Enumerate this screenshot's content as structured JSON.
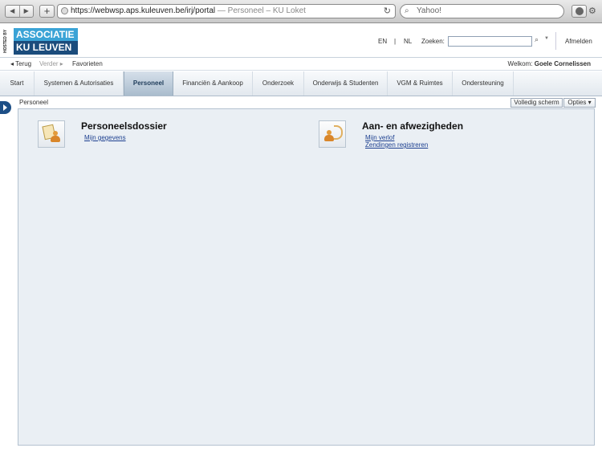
{
  "browser": {
    "url": "https://webwsp.aps.kuleuven.be/irj/portal",
    "page_title": "— Personeel – KU Loket",
    "search_placeholder": "Yahoo!"
  },
  "header": {
    "hosted_by": "HOSTED BY",
    "logo_line1": "ASSOCIATIE",
    "logo_line2": "KU LEUVEN",
    "lang_en": "EN",
    "lang_sep": "|",
    "lang_nl": "NL",
    "search_label": "Zoeken:",
    "logout": "Afmelden"
  },
  "subheader": {
    "back": "◂ Terug",
    "forward": "Verder ▸",
    "favorites": "Favorieten",
    "welcome_prefix": "Welkom: ",
    "user_name": "Goele Cornelissen"
  },
  "tabs": [
    {
      "label": "Start"
    },
    {
      "label": "Systemen & Autorisaties"
    },
    {
      "label": "Personeel"
    },
    {
      "label": "Financiën & Aankoop"
    },
    {
      "label": "Onderzoek"
    },
    {
      "label": "Onderwijs & Studenten"
    },
    {
      "label": "VGM & Ruimtes"
    },
    {
      "label": "Ondersteuning"
    }
  ],
  "active_tab": "Personeel",
  "breadcrumb": "Personeel",
  "buttons": {
    "full_screen": "Volledig scherm",
    "options": "Opties ▾"
  },
  "panels": [
    {
      "title": "Personeelsdossier",
      "icon": "personnel-file-icon",
      "links": [
        "Mijn gegevens"
      ]
    },
    {
      "title": "Aan- en afwezigheden",
      "icon": "attendance-icon",
      "links": [
        "Mijn verlof",
        "Zendingen registreren"
      ]
    }
  ],
  "colors": {
    "logo_light": "#3aa3d6",
    "logo_dark": "#1b4c7c",
    "link": "#1c3f8f",
    "content_bg": "#eaeff4"
  }
}
